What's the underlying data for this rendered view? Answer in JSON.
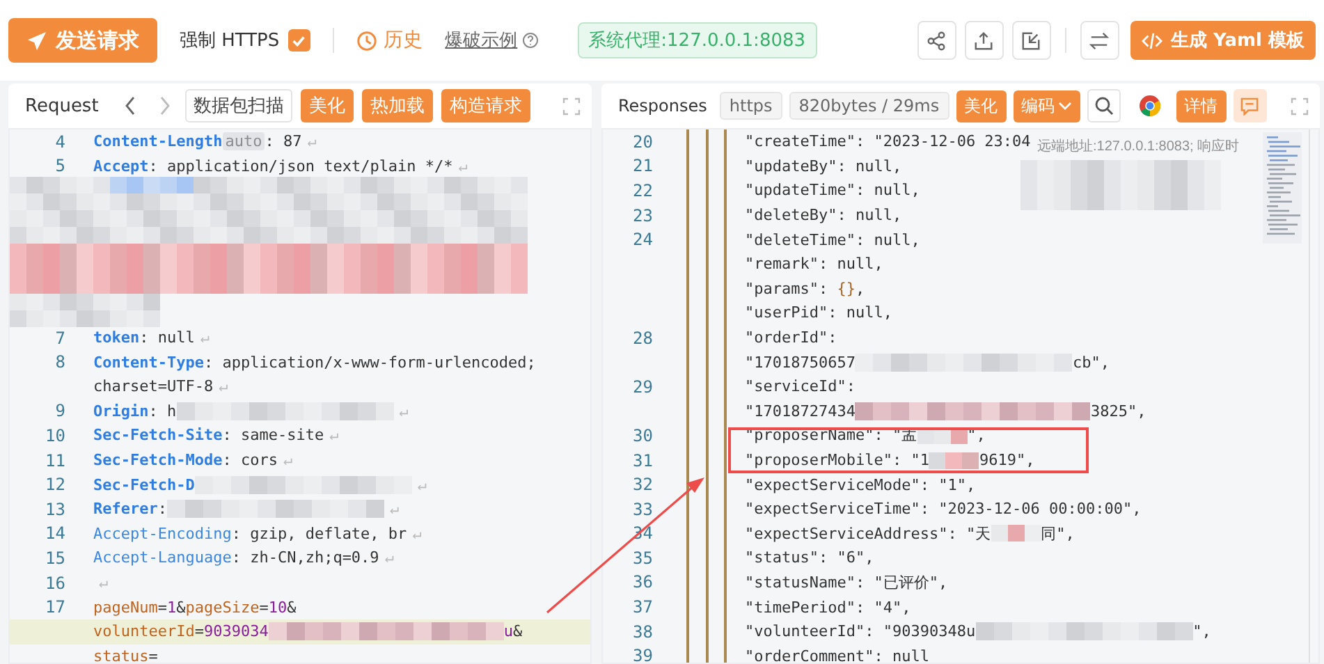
{
  "toolbar": {
    "send_button": "发送请求",
    "https": {
      "label": "强制 HTTPS",
      "checked": true
    },
    "history": "历史",
    "fuzz_example": "爆破示例",
    "proxy_badge": "系统代理:127.0.0.1:8083",
    "yaml_button": "生成 Yaml 模板"
  },
  "request": {
    "title": "Request",
    "scan_button": "数据包扫描",
    "buttons": [
      "美化",
      "热加载",
      "构造请求"
    ],
    "lines": [
      {
        "kind": "code",
        "n": "4",
        "highlighted": false,
        "segs": [
          {
            "kind": "key",
            "t": "Content-Length"
          },
          {
            "kind": "badge",
            "t": "auto"
          },
          {
            "kind": "val",
            "t": ": 87"
          },
          {
            "kind": "eol",
            "t": "↵"
          }
        ]
      },
      {
        "kind": "code",
        "n": "5",
        "highlighted": false,
        "segs": [
          {
            "kind": "key",
            "t": "Accept"
          },
          {
            "kind": "val",
            "t": ": application/json text/plain */*"
          },
          {
            "kind": "eol",
            "t": "↵"
          }
        ]
      },
      {
        "kind": "redacted_block"
      },
      {
        "kind": "code",
        "n": "7",
        "highlighted": false,
        "segs": [
          {
            "kind": "key",
            "t": "token"
          },
          {
            "kind": "val",
            "t": ": null"
          },
          {
            "kind": "eol",
            "t": "↵"
          }
        ]
      },
      {
        "kind": "code",
        "n": "8",
        "highlighted": false,
        "segs": [
          {
            "kind": "key",
            "t": "Content-Type"
          },
          {
            "kind": "val",
            "t": ": application/x-www-form-urlencoded;"
          }
        ]
      },
      {
        "kind": "code",
        "highlighted": false,
        "segs": [
          {
            "kind": "val",
            "t": "charset=UTF-8"
          },
          {
            "kind": "eol",
            "t": "↵"
          }
        ]
      },
      {
        "kind": "code",
        "n": "9",
        "highlighted": false,
        "segs": [
          {
            "kind": "key",
            "t": "Origin"
          },
          {
            "kind": "val",
            "t": ": h"
          },
          {
            "kind": "blur"
          },
          {
            "kind": "eol",
            "t": "↵"
          }
        ]
      },
      {
        "kind": "code",
        "n": "10",
        "highlighted": false,
        "segs": [
          {
            "kind": "key",
            "t": "Sec-Fetch-Site"
          },
          {
            "kind": "val",
            "t": ": same-site"
          },
          {
            "kind": "eol",
            "t": "↵"
          }
        ]
      },
      {
        "kind": "code",
        "n": "11",
        "highlighted": false,
        "segs": [
          {
            "kind": "key",
            "t": "Sec-Fetch-Mode"
          },
          {
            "kind": "val",
            "t": ": cors"
          },
          {
            "kind": "eol",
            "t": "↵"
          }
        ]
      },
      {
        "kind": "code",
        "n": "12",
        "highlighted": false,
        "segs": [
          {
            "kind": "key",
            "t": "Sec-Fetch-D"
          },
          {
            "kind": "blur"
          },
          {
            "kind": "eol",
            "t": "↵"
          }
        ]
      },
      {
        "kind": "code",
        "n": "13",
        "highlighted": false,
        "segs": [
          {
            "kind": "key",
            "t": "Referer"
          },
          {
            "kind": "val",
            "t": ":"
          },
          {
            "kind": "blur"
          },
          {
            "kind": "eol",
            "t": "↵"
          }
        ]
      },
      {
        "kind": "code",
        "n": "14",
        "highlighted": false,
        "segs": [
          {
            "kind": "key2",
            "t": "Accept-Encoding"
          },
          {
            "kind": "val",
            "t": ": gzip, deflate, br"
          },
          {
            "kind": "eol",
            "t": "↵"
          }
        ]
      },
      {
        "kind": "code",
        "n": "15",
        "highlighted": false,
        "segs": [
          {
            "kind": "key2",
            "t": "Accept-Language"
          },
          {
            "kind": "val",
            "t": ": zh-CN,zh;q=0.9"
          },
          {
            "kind": "eol",
            "t": "↵"
          }
        ]
      },
      {
        "kind": "code",
        "n": "16",
        "highlighted": false,
        "segs": [
          {
            "kind": "eol",
            "t": "↵"
          }
        ]
      },
      {
        "kind": "code",
        "n": "17",
        "highlighted": false,
        "segs": [
          {
            "kind": "param",
            "t": "pageNum"
          },
          {
            "kind": "val",
            "t": "="
          },
          {
            "kind": "num",
            "t": "1"
          },
          {
            "kind": "val",
            "t": "&"
          },
          {
            "kind": "param",
            "t": "pageSize"
          },
          {
            "kind": "val",
            "t": "="
          },
          {
            "kind": "num",
            "t": "10"
          },
          {
            "kind": "val",
            "t": "&"
          }
        ]
      },
      {
        "kind": "code",
        "highlighted": true,
        "segs": [
          {
            "kind": "param",
            "t": "volunteerId"
          },
          {
            "kind": "val",
            "t": "="
          },
          {
            "kind": "num",
            "t": "9039034"
          },
          {
            "kind": "blur_pink"
          },
          {
            "kind": "num",
            "t": "u"
          },
          {
            "kind": "val",
            "t": "&"
          }
        ]
      },
      {
        "kind": "code",
        "highlighted": false,
        "segs": [
          {
            "kind": "param",
            "t": "status"
          },
          {
            "kind": "val",
            "t": "="
          }
        ]
      }
    ]
  },
  "response": {
    "title": "Responses",
    "protocol": "https",
    "stats": "820bytes / 29ms",
    "beautify": "美化",
    "encoding": "编码",
    "details": "详情",
    "tooltip": "远端地址:127.0.0.1:8083; 响应时",
    "lines": [
      {
        "n": "20",
        "segs": [
          {
            "kind": "str",
            "t": "\"createTime\": \"2023-12-06 23:04"
          }
        ]
      },
      {
        "n": "21",
        "segs": [
          {
            "kind": "str",
            "t": "\"updateBy\": null,"
          }
        ]
      },
      {
        "n": "22",
        "segs": [
          {
            "kind": "str",
            "t": "\"updateTime\": null,"
          }
        ]
      },
      {
        "n": "23",
        "segs": [
          {
            "kind": "str",
            "t": "\"deleteBy\": null,"
          }
        ]
      },
      {
        "n": "24",
        "segs": [
          {
            "kind": "str",
            "t": "\"deleteTime\": null,"
          }
        ]
      },
      {
        "segs": [
          {
            "kind": "str",
            "t": "\"remark\": null,"
          }
        ]
      },
      {
        "segs": [
          {
            "kind": "str",
            "t": "\"params\": "
          },
          {
            "kind": "brace",
            "t": "{}"
          },
          {
            "kind": "str",
            "t": ","
          }
        ]
      },
      {
        "segs": [
          {
            "kind": "str",
            "t": "\"userPid\": null,"
          }
        ]
      },
      {
        "n": "28",
        "segs": [
          {
            "kind": "str",
            "t": "\"orderId\":"
          }
        ]
      },
      {
        "segs": [
          {
            "kind": "str",
            "t": "\"17018750657"
          },
          {
            "kind": "blur"
          },
          {
            "kind": "str",
            "t": "cb\","
          }
        ]
      },
      {
        "n": "29",
        "segs": [
          {
            "kind": "str",
            "t": "\"serviceId\":"
          }
        ]
      },
      {
        "segs": [
          {
            "kind": "str",
            "t": "\"17018727434"
          },
          {
            "kind": "blur_pink"
          },
          {
            "kind": "str",
            "t": "3825\","
          }
        ]
      },
      {
        "n": "30",
        "segs": [
          {
            "kind": "str",
            "t": "\"proposerName\": \"孟"
          },
          {
            "kind": "blur_short"
          },
          {
            "kind": "str",
            "t": "\","
          }
        ]
      },
      {
        "n": "31",
        "segs": [
          {
            "kind": "str",
            "t": "\"proposerMobile\": \"1"
          },
          {
            "kind": "blur_short"
          },
          {
            "kind": "str",
            "t": "9619\","
          }
        ]
      },
      {
        "n": "32",
        "segs": [
          {
            "kind": "str",
            "t": "\"expectServiceMode\": \"1\","
          }
        ]
      },
      {
        "n": "33",
        "segs": [
          {
            "kind": "str",
            "t": "\"expectServiceTime\": \"2023-12-06 00:00:00\","
          }
        ]
      },
      {
        "n": "34",
        "segs": [
          {
            "kind": "str",
            "t": "\"expectServiceAddress\": \"天"
          },
          {
            "kind": "blur_short"
          },
          {
            "kind": "str",
            "t": "同\","
          }
        ]
      },
      {
        "n": "35",
        "segs": [
          {
            "kind": "str",
            "t": "\"status\": \"6\","
          }
        ]
      },
      {
        "n": "36",
        "segs": [
          {
            "kind": "str",
            "t": "\"statusName\": \"已评价\","
          }
        ]
      },
      {
        "n": "37",
        "segs": [
          {
            "kind": "str",
            "t": "\"timePeriod\": \"4\","
          }
        ]
      },
      {
        "n": "38",
        "segs": [
          {
            "kind": "str",
            "t": "\"volunteerId\": \"90390348u"
          },
          {
            "kind": "blur"
          },
          {
            "kind": "str",
            "t": "\","
          }
        ]
      },
      {
        "n": "39",
        "segs": [
          {
            "kind": "str",
            "t": "\"orderComment\": null"
          }
        ]
      }
    ]
  }
}
